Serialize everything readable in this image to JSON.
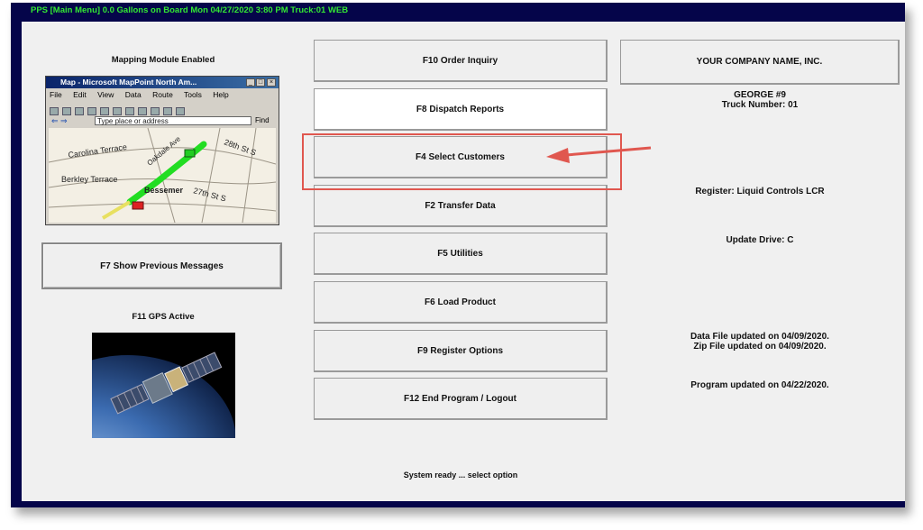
{
  "titlebar": {
    "text": "PPS [Main Menu] 0.0 Gallons on Board  Mon 04/27/2020  3:80 PM  Truck:01  WEB"
  },
  "left": {
    "mapping_label": "Mapping Module Enabled",
    "map_window": {
      "title": "Map - Microsoft MapPoint North Am...",
      "menu": [
        "File",
        "Edit",
        "View",
        "Data",
        "Route",
        "Tools",
        "Help"
      ],
      "address_placeholder": "Type place or address",
      "find_label": "Find",
      "streets": [
        "Carolina Terrace",
        "Berkley Terrace",
        "Bessemer",
        "28th St S",
        "27th St S",
        "Oakdale Ave"
      ]
    },
    "prev_messages_button": "F7  Show Previous Messages",
    "gps_label": "F11 GPS Active"
  },
  "menu_buttons": [
    {
      "label": "F10 Order Inquiry"
    },
    {
      "label": "F8  Dispatch Reports"
    },
    {
      "label": "F4  Select Customers"
    },
    {
      "label": "F2  Transfer Data"
    },
    {
      "label": "F5  Utilities"
    },
    {
      "label": "F6  Load Product"
    },
    {
      "label": "F9  Register Options"
    },
    {
      "label": "F12  End Program / Logout"
    }
  ],
  "right": {
    "company_name": "YOUR COMPANY NAME, INC.",
    "driver": "GEORGE  #9",
    "truck_number": "Truck Number: 01",
    "register": "Register: Liquid Controls LCR",
    "update_drive": "Update Drive: C",
    "data_file": "Data File updated on 04/09/2020.",
    "zip_file": "Zip File updated on 04/09/2020.",
    "program_updated": "Program updated on 04/22/2020."
  },
  "status_text": "System ready ... select option",
  "colors": {
    "frame": "#05054a",
    "title_text": "#33e833",
    "highlight": "#e0574f",
    "panel": "#f0f0f0"
  }
}
